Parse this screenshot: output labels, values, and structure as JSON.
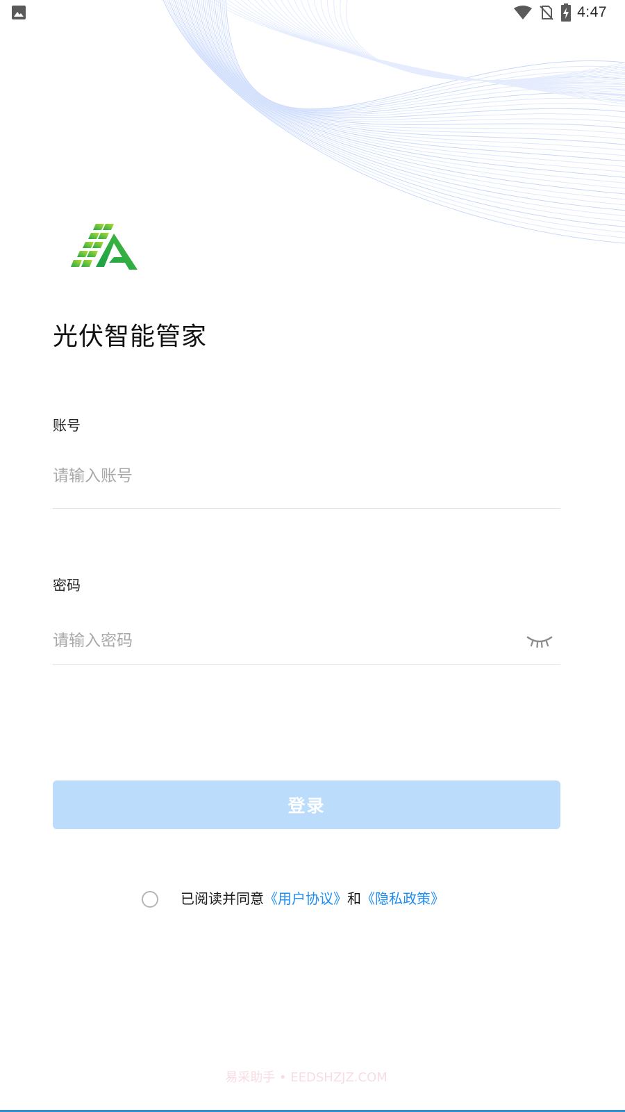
{
  "status_bar": {
    "time": "4:47",
    "icons": [
      "gallery-icon",
      "wifi-icon",
      "no-sim-icon",
      "battery-charging-icon"
    ]
  },
  "app": {
    "title": "光伏智能管家",
    "logo": "solar-panel-a-logo"
  },
  "form": {
    "account": {
      "label": "账号",
      "placeholder": "请输入账号",
      "value": ""
    },
    "password": {
      "label": "密码",
      "placeholder": "请输入密码",
      "value": "",
      "toggle_icon": "eye-closed-icon"
    },
    "login_button": "登录"
  },
  "agreement": {
    "checked": false,
    "prefix": "已阅读并同意",
    "user_agreement": "《用户协议》",
    "conjunction": "和",
    "privacy_policy": "《隐私政策》"
  },
  "watermark": "易采助手 • EEDSHZJZ.COM",
  "colors": {
    "accent": "#1f8ef1",
    "button_disabled": "#bcdcfb",
    "logo_green": "#2db34a",
    "logo_yellow_green": "#a8d82e"
  }
}
